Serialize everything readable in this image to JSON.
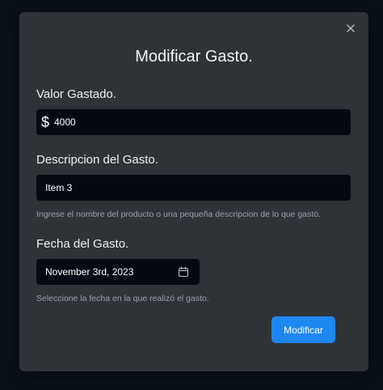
{
  "dialog": {
    "title": "Modificar Gasto.",
    "close_icon": "close-icon"
  },
  "amount": {
    "label": "Valor Gastado.",
    "prefix_icon": "dollar-icon",
    "value": "4000"
  },
  "description": {
    "label": "Descripcion del Gasto.",
    "value": "Item 3",
    "help": "Ingrese el nombre del producto o una pequeña descripcion de lo que gastó."
  },
  "date": {
    "label": "Fecha del Gasto.",
    "value": "November 3rd, 2023",
    "icon": "calendar-icon",
    "help": "Seleccione la fecha en la que realizó el gasto."
  },
  "actions": {
    "submit_label": "Modificar",
    "submit_color": "#1e88f0"
  }
}
